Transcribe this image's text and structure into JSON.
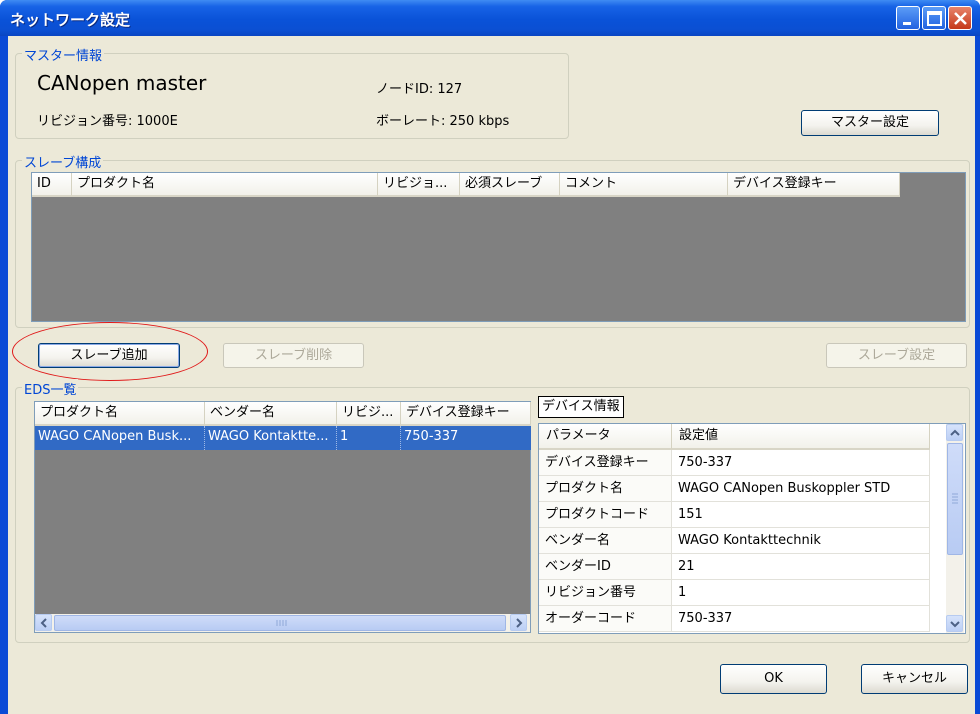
{
  "window": {
    "title": "ネットワーク設定"
  },
  "master": {
    "group_title": "マスター情報",
    "name": "CANopen master",
    "revision_label": "リビジョン番号: 1000E",
    "node_id_label": "ノードID: 127",
    "baudrate_label": "ボーレート: 250 kbps",
    "settings_button": "マスター設定"
  },
  "slave_config": {
    "group_title": "スレーブ構成",
    "columns": [
      "ID",
      "プロダクト名",
      "リビジョ...",
      "必須スレーブ",
      "コメント",
      "デバイス登録キー"
    ],
    "rows": []
  },
  "slave_buttons": {
    "add": "スレーブ追加",
    "delete": "スレーブ削除",
    "settings": "スレーブ設定"
  },
  "eds": {
    "group_title": "EDS一覧",
    "columns": [
      "プロダクト名",
      "ベンダー名",
      "リビジ...",
      "デバイス登録キー"
    ],
    "rows": [
      [
        "WAGO CANopen Busk...",
        "WAGO Kontaktte...",
        "1",
        "750-337"
      ]
    ]
  },
  "device_info": {
    "tab_label": "デバイス情報",
    "columns": [
      "パラメータ",
      "設定値"
    ],
    "rows": [
      [
        "デバイス登録キー",
        "750-337"
      ],
      [
        "プロダクト名",
        "WAGO CANopen Buskoppler STD"
      ],
      [
        "プロダクトコード",
        "151"
      ],
      [
        "ベンダー名",
        "WAGO Kontakttechnik"
      ],
      [
        "ベンダーID",
        "21"
      ],
      [
        "リビジョン番号",
        "1"
      ],
      [
        "オーダーコード",
        "750-337"
      ]
    ]
  },
  "dialog_buttons": {
    "ok": "OK",
    "cancel": "キャンセル"
  },
  "colors": {
    "accent": "#0046d5",
    "selection": "#316ac5",
    "highlight_circle": "#e01a1a"
  }
}
